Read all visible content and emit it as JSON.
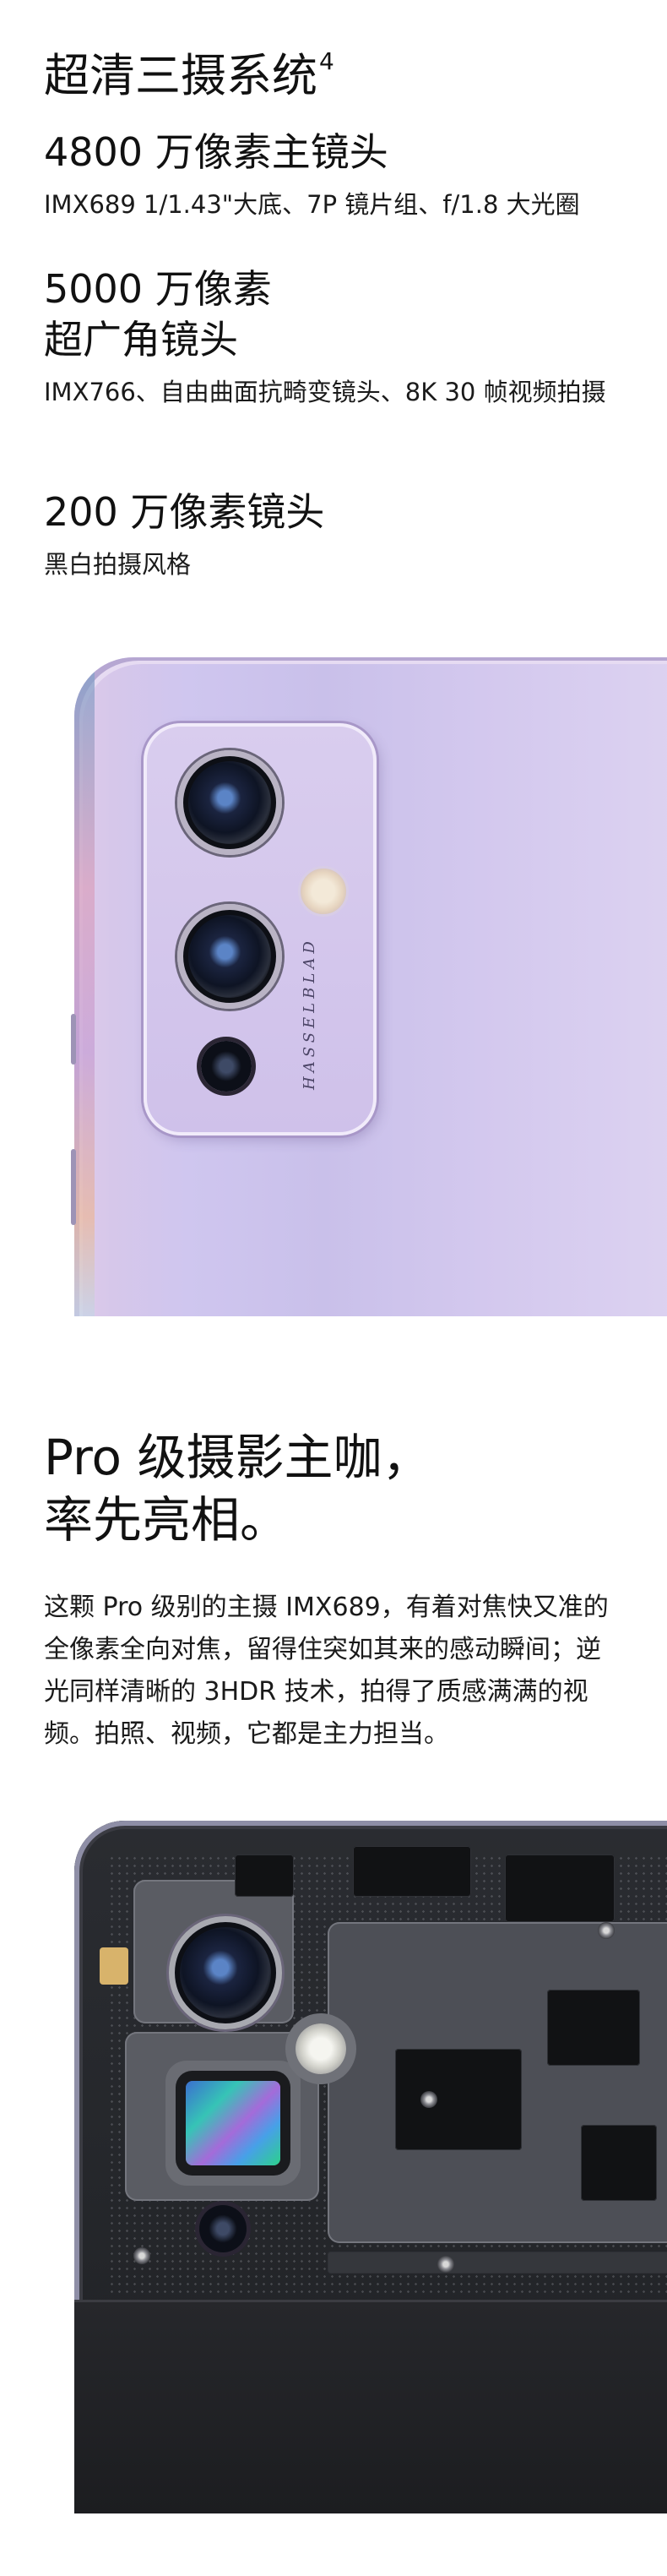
{
  "section_camera": {
    "title": "超清三摄系统",
    "title_sup": "4",
    "cameras": [
      {
        "name": "4800 万像素主镜头",
        "desc": "IMX689  1/1.43\"大底、7P 镜片组、f/1.8 大光圈"
      },
      {
        "name_line1": "5000 万像素",
        "name_line2": "超广角镜头",
        "desc": "IMX766、自由曲面抗畸变镜头、8K 30 帧视频拍摄"
      },
      {
        "name": "200 万像素镜头",
        "desc": "黑白拍摄风格"
      }
    ],
    "module_brand": "HASSELBLAD"
  },
  "section_pro": {
    "heading_line1": "Pro 级摄影主咖，",
    "heading_line2": "率先亮相。",
    "body": "这颗 Pro 级别的主摄 IMX689，有着对焦快又准的全像素全向对焦，留得住突如其来的感动瞬间；逆光同样清晰的 3HDR 技术，拍得了质感满满的视频。拍照、视频，它都是主力担当。"
  },
  "colors": {
    "phone_purple": "#cfc6ef",
    "internal_dark": "#2a2c31"
  }
}
